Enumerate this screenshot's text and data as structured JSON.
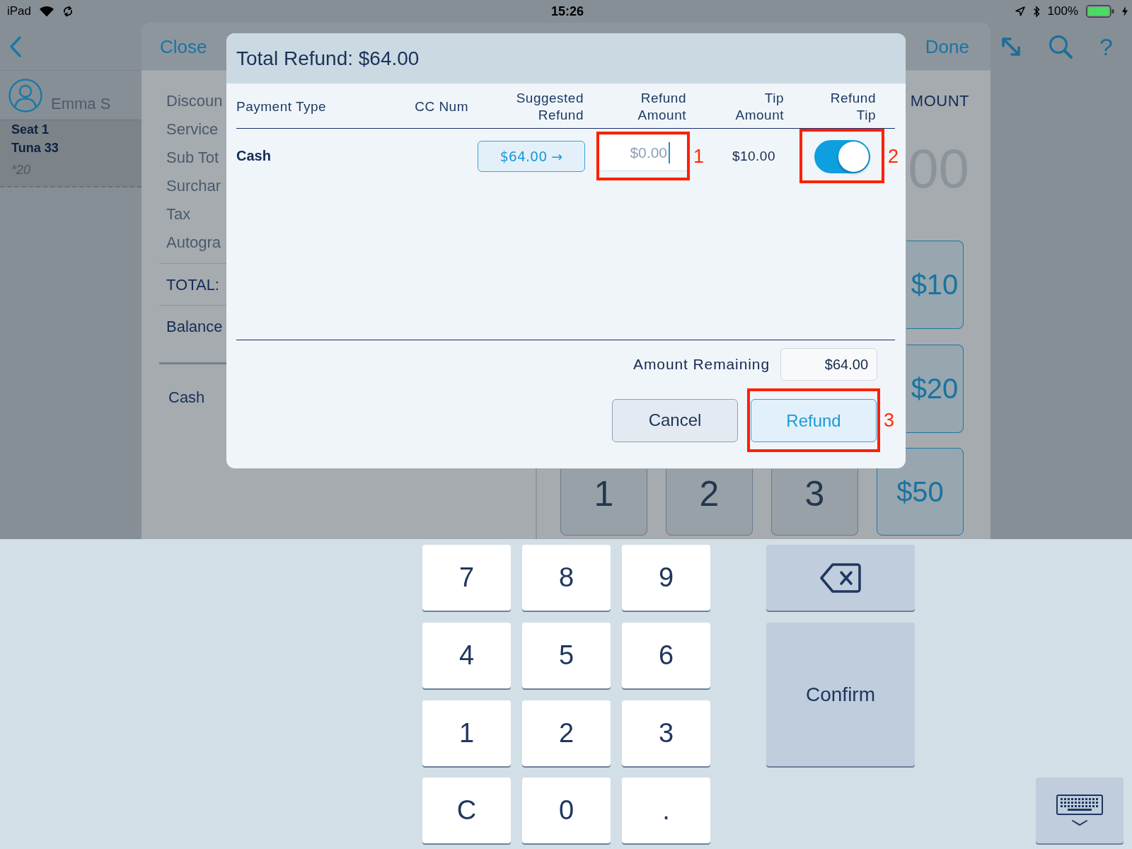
{
  "status_bar": {
    "device": "iPad",
    "time": "15:26",
    "battery": "100%"
  },
  "customer": {
    "name": "Emma S",
    "seat": "Seat 1",
    "item": "Tuna 33",
    "note": "*20"
  },
  "order_panel": {
    "close": "Close",
    "done": "Done",
    "summary": [
      {
        "label": "Discoun",
        "kind": "charge"
      },
      {
        "label": "Service",
        "kind": "charge"
      },
      {
        "label": "Sub Tot",
        "kind": "charge"
      },
      {
        "label": "Surchar",
        "kind": "charge"
      },
      {
        "label": "Tax",
        "kind": "charge"
      },
      {
        "label": "Autogra",
        "kind": "charge"
      },
      {
        "label": "TOTAL:",
        "kind": "total"
      },
      {
        "label": "Balance",
        "kind": "balance"
      }
    ],
    "payments": [
      "Cash"
    ],
    "amount_heading": "MOUNT",
    "amount_value": "00",
    "quick_amounts": [
      "$10",
      "$20"
    ],
    "bottom_row": [
      {
        "label": "1",
        "kind": "digit"
      },
      {
        "label": "2",
        "kind": "digit"
      },
      {
        "label": "3",
        "kind": "digit"
      },
      {
        "label": "$50",
        "kind": "amount"
      }
    ]
  },
  "toolbar": {
    "help": "?"
  },
  "refund_dialog": {
    "title": "Total Refund: $64.00",
    "columns": [
      "Payment Type",
      "CC Num",
      "Suggested\nRefund",
      "Refund\nAmount",
      "Tip\nAmount",
      "Refund\nTip"
    ],
    "rows": [
      {
        "payment_type": "Cash",
        "suggested_refund": "$64.00 →",
        "refund_amount": {
          "placeholder": "$0.00",
          "focused": true,
          "callout": "1"
        },
        "tip_amount": "$10.00",
        "refund_tip": {
          "on": true,
          "callout": "2"
        }
      }
    ],
    "amount_remaining": {
      "label": "Amount Remaining",
      "value": "$64.00"
    },
    "buttons": [
      {
        "label": "Cancel",
        "kind": "secondary"
      },
      {
        "label": "Refund",
        "kind": "primary",
        "callout": "3"
      }
    ]
  },
  "keyboard": {
    "keys": [
      "7",
      "8",
      "9",
      "4",
      "5",
      "6",
      "1",
      "2",
      "3",
      "C",
      "0",
      "."
    ],
    "confirm": "Confirm"
  }
}
